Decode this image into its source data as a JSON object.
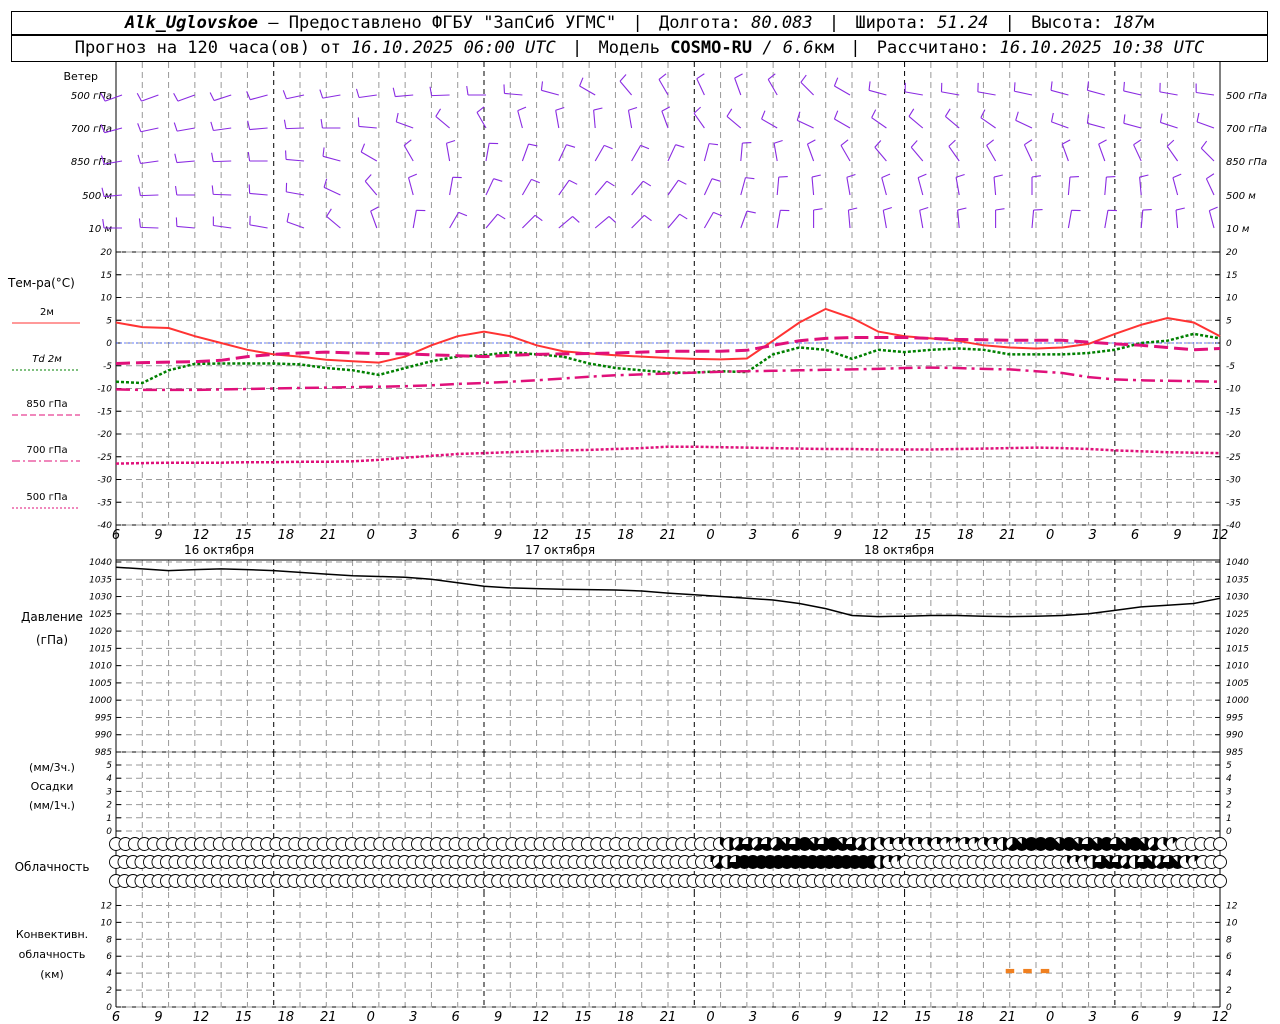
{
  "header": {
    "station": "Alk_Uglovskoe",
    "provider": "– Предоставлено ФГБУ \"ЗапСиб УГМС\"",
    "lon_label": "Долгота:",
    "lon_value": "80.083",
    "lat_label": "Широта:",
    "lat_value": "51.24",
    "alt_label": "Высота:",
    "alt_value": "187",
    "alt_unit": "м",
    "forecast_label": "Прогноз на 120 часа(ов) от",
    "forecast_time": "16.10.2025 06:00 UTC",
    "model_label": "Модель",
    "model_name": "COSMO-RU",
    "model_res": "/ 6.6",
    "model_res_unit": "км",
    "calc_label": "Рассчитано:",
    "calc_time": "16.10.2025 10:38 UTC"
  },
  "wind_panel": {
    "title": "Ветер",
    "levels": [
      "500 гПа",
      "700 гПа",
      "850 гПа",
      "500 м",
      "10 м"
    ]
  },
  "temp_panel": {
    "title": "Тем-ра(°C)",
    "legend": [
      {
        "label": "2м",
        "color": "#ff3333",
        "style": "solid"
      },
      {
        "label": "Td 2м",
        "color": "#008000",
        "style": "dotted"
      },
      {
        "label": "850 гПа",
        "color": "#e0107a",
        "style": "dashed"
      },
      {
        "label": "700 гПа",
        "color": "#e0107a",
        "style": "dashdot"
      },
      {
        "label": "500 гПа",
        "color": "#e0107a",
        "style": "dotted"
      }
    ],
    "yticks": [
      20,
      15,
      10,
      5,
      0,
      -5,
      -10,
      -15,
      -20,
      -25,
      -30,
      -35,
      -40
    ],
    "xticks": [
      "6",
      "9",
      "12",
      "15",
      "18",
      "21",
      "0",
      "3",
      "6",
      "9",
      "12",
      "15",
      "18",
      "21",
      "0",
      "3",
      "6",
      "9",
      "12",
      "15",
      "18",
      "21",
      "0",
      "3",
      "6",
      "9",
      "12"
    ],
    "dates": [
      "16 октября",
      "17 октября",
      "18 октября"
    ]
  },
  "pressure_panel": {
    "title1": "Давление",
    "title2": "(гПа)",
    "yticks": [
      1040,
      1035,
      1030,
      1025,
      1020,
      1015,
      1010,
      1005,
      1000,
      995,
      990,
      985
    ]
  },
  "precip_panel": {
    "title1": "(мм/3ч.)",
    "title2": "Осадки",
    "title3": "(мм/1ч.)",
    "yticks": [
      5,
      4,
      3,
      2,
      1,
      0
    ]
  },
  "cloud_panel": {
    "title": "Облачность"
  },
  "convective_panel": {
    "title1": "Конвективн.",
    "title2": "облачность",
    "title3": "(км)",
    "yticks": [
      12,
      10,
      8,
      6,
      4,
      2,
      0
    ],
    "bar_color": "#f08020"
  },
  "chart_data": [
    {
      "type": "line",
      "name": "Температура",
      "x_hours": [
        0,
        3,
        6,
        9,
        12,
        15,
        18,
        21,
        24,
        27,
        30,
        33,
        36,
        39,
        42,
        45,
        48,
        51,
        54,
        57,
        60,
        63,
        66,
        69,
        72,
        75,
        78,
        81,
        84,
        87,
        90,
        93,
        96,
        99,
        102,
        105,
        108,
        111,
        114,
        117,
        120,
        123,
        126
      ],
      "ylim": [
        -40,
        20
      ],
      "series": [
        {
          "name": "2м",
          "values": [
            4.5,
            3.5,
            3.3,
            1.5,
            0,
            -1.5,
            -2.5,
            -3,
            -3.7,
            -4,
            -4.3,
            -3,
            -0.5,
            1.5,
            2.5,
            1.5,
            -0.5,
            -1.8,
            -2.3,
            -2.7,
            -3,
            -3.3,
            -3.5,
            -3.6,
            -3.4,
            0.5,
            4.5,
            7.5,
            5.5,
            2.5,
            1.5,
            1,
            0.5,
            -0.5,
            -1,
            -1.2,
            -1,
            -0.2,
            2,
            4,
            5.5,
            4.5,
            1.5
          ]
        },
        {
          "name": "Td 2м",
          "values": [
            -8.5,
            -8.8,
            -6,
            -4.6,
            -4.5,
            -4.5,
            -4.5,
            -4.7,
            -5.5,
            -6,
            -7,
            -5.5,
            -4,
            -3,
            -2.7,
            -2,
            -2.5,
            -3,
            -4.5,
            -5.5,
            -6,
            -6.5,
            -6.5,
            -6.2,
            -6.4,
            -2.5,
            -1,
            -1.5,
            -3.5,
            -1.5,
            -2,
            -1.5,
            -1.2,
            -1.5,
            -2.5,
            -2.5,
            -2.5,
            -2.2,
            -1.5,
            0,
            0.5,
            2,
            1
          ]
        },
        {
          "name": "850 гПа",
          "values": [
            -4.5,
            -4.3,
            -4.2,
            -4.1,
            -3.8,
            -3,
            -2.5,
            -2.2,
            -2,
            -2.2,
            -2.3,
            -2.4,
            -2.6,
            -2.8,
            -3,
            -2.7,
            -2.5,
            -2.4,
            -2.3,
            -2.2,
            -2,
            -1.8,
            -1.8,
            -1.8,
            -1.6,
            -0.5,
            0.5,
            1,
            1.2,
            1.2,
            1.2,
            1,
            0.8,
            0.7,
            0.6,
            0.6,
            0.6,
            0.2,
            -0.2,
            -0.5,
            -1,
            -1.5,
            -1.2
          ]
        },
        {
          "name": "700 гПа",
          "values": [
            -10.2,
            -10.3,
            -10.3,
            -10.3,
            -10.2,
            -10.1,
            -10,
            -9.9,
            -9.8,
            -9.7,
            -9.6,
            -9.5,
            -9.3,
            -9,
            -8.8,
            -8.5,
            -8.2,
            -7.8,
            -7.4,
            -7.1,
            -6.9,
            -6.7,
            -6.5,
            -6.3,
            -6.2,
            -6.1,
            -6,
            -5.9,
            -5.8,
            -5.7,
            -5.5,
            -5.4,
            -5.5,
            -5.7,
            -5.8,
            -6.2,
            -6.6,
            -7.5,
            -8,
            -8.2,
            -8.3,
            -8.4,
            -8.5
          ]
        },
        {
          "name": "500 гПа",
          "values": [
            -26.5,
            -26.4,
            -26.3,
            -26.3,
            -26.3,
            -26.2,
            -26.2,
            -26.1,
            -26.1,
            -26,
            -25.7,
            -25.2,
            -24.8,
            -24.4,
            -24.2,
            -24,
            -23.8,
            -23.6,
            -23.5,
            -23.3,
            -23.1,
            -22.8,
            -22.8,
            -22.9,
            -23,
            -23.1,
            -23.2,
            -23.3,
            -23.3,
            -23.4,
            -23.4,
            -23.4,
            -23.3,
            -23.2,
            -23.1,
            -23,
            -23.1,
            -23.3,
            -23.6,
            -23.8,
            -24,
            -24.1,
            -24.2
          ]
        }
      ]
    },
    {
      "type": "line",
      "name": "Давление",
      "x_hours": [
        0,
        3,
        6,
        9,
        12,
        15,
        18,
        21,
        24,
        27,
        30,
        33,
        36,
        39,
        42,
        45,
        48,
        51,
        54,
        57,
        60,
        63,
        66,
        69,
        72,
        75,
        78,
        81,
        84,
        87,
        90,
        93,
        96,
        99,
        102,
        105,
        108,
        111,
        114,
        117,
        120,
        123,
        126
      ],
      "ylim": [
        985,
        1040
      ],
      "series": [
        {
          "name": "Давление",
          "values": [
            1038.5,
            1038,
            1037.5,
            1037.8,
            1038,
            1037.8,
            1037.5,
            1037,
            1036.5,
            1036,
            1035.8,
            1035.6,
            1035,
            1034,
            1033,
            1032.5,
            1032.3,
            1032.1,
            1032,
            1031.9,
            1031.6,
            1031,
            1030.5,
            1030,
            1029.5,
            1029,
            1028,
            1026.5,
            1024.5,
            1024.2,
            1024.3,
            1024.5,
            1024.5,
            1024.3,
            1024.2,
            1024.3,
            1024.5,
            1025,
            1026,
            1027,
            1027.5,
            1028,
            1029.5
          ]
        }
      ]
    },
    {
      "type": "bar",
      "name": "Конвективная облачность",
      "x_hours": [
        102,
        104,
        106
      ],
      "bar_range_km": [
        [
          4,
          4.5
        ],
        [
          4,
          4.5
        ],
        [
          4,
          4.5
        ]
      ]
    }
  ],
  "cloud_cover": {
    "rows": [
      [
        0,
        0,
        0,
        0,
        0,
        0,
        0,
        0,
        0,
        0,
        0,
        0,
        0,
        0,
        0,
        0,
        0,
        0,
        0,
        0,
        0,
        0,
        0,
        0,
        0,
        0,
        0,
        0,
        0,
        0,
        0,
        0,
        0,
        0,
        0,
        0,
        0,
        0,
        0,
        0,
        0,
        0,
        0,
        0,
        0,
        0,
        0,
        0,
        0,
        0,
        0,
        0,
        0,
        0,
        0,
        0,
        0,
        0,
        0,
        0,
        0,
        0,
        0,
        0,
        3,
        4,
        5,
        6,
        5,
        6,
        5,
        7,
        6,
        8,
        7,
        6,
        8,
        7,
        6,
        5,
        4,
        3,
        2,
        2,
        3,
        2,
        3,
        2,
        1,
        1,
        2,
        1,
        3,
        2,
        4,
        5,
        7,
        8,
        8,
        8,
        7,
        8,
        7,
        6,
        7,
        8,
        6,
        7,
        8,
        7,
        5,
        3,
        1,
        0,
        0,
        0,
        0,
        0
      ],
      [
        0,
        0,
        0,
        0,
        0,
        0,
        0,
        0,
        0,
        0,
        0,
        0,
        0,
        0,
        0,
        0,
        0,
        0,
        0,
        0,
        0,
        0,
        0,
        0,
        0,
        0,
        0,
        0,
        0,
        0,
        0,
        0,
        0,
        0,
        0,
        0,
        0,
        0,
        0,
        0,
        0,
        0,
        0,
        0,
        0,
        0,
        0,
        0,
        0,
        0,
        0,
        0,
        0,
        0,
        0,
        0,
        0,
        0,
        0,
        0,
        0,
        0,
        0,
        0,
        0,
        0,
        0,
        0,
        0,
        0,
        2,
        5,
        4,
        6,
        8,
        8,
        8,
        8,
        8,
        8,
        8,
        8,
        8,
        8,
        8,
        8,
        8,
        8,
        8,
        8,
        4,
        2,
        1,
        0,
        0,
        0,
        0,
        0,
        0,
        0,
        0,
        0,
        0,
        0,
        0,
        0,
        0,
        0,
        0,
        0,
        0,
        0,
        3,
        2,
        1,
        4,
        6,
        7,
        6,
        5,
        4,
        6,
        7,
        5,
        6,
        7,
        3,
        1,
        0,
        0,
        0
      ],
      [
        0,
        0,
        0,
        0,
        0,
        0,
        0,
        0,
        0,
        0,
        0,
        0,
        0,
        0,
        0,
        0,
        0,
        0,
        0,
        0,
        0,
        0,
        0,
        0,
        0,
        0,
        0,
        0,
        0,
        0,
        0,
        0,
        0,
        0,
        0,
        0,
        0,
        0,
        0,
        0,
        0,
        0,
        0,
        0,
        0,
        0,
        0,
        0,
        0,
        0,
        0,
        0,
        0,
        0,
        0,
        0,
        0,
        0,
        0,
        0,
        0,
        0,
        0,
        0,
        0,
        0,
        0,
        0,
        0,
        0,
        0,
        0,
        0,
        0,
        0,
        0,
        0,
        0,
        0,
        0,
        0,
        0,
        0,
        0,
        0,
        0,
        0,
        0,
        0,
        0,
        0,
        0,
        0,
        0,
        0,
        0,
        0,
        0,
        0,
        0,
        0,
        0,
        0,
        0,
        0,
        0,
        0,
        0,
        0,
        0,
        0,
        0,
        0,
        0,
        0,
        0,
        0,
        0,
        0,
        0,
        0,
        0,
        0,
        0,
        0,
        0,
        0,
        0,
        0,
        0,
        0
      ]
    ]
  },
  "wind": {
    "levels": [
      {
        "name": "500 гПа",
        "dirs": [
          250,
          250,
          250,
          252,
          255,
          258,
          260,
          262,
          265,
          268,
          270,
          275,
          285,
          300,
          320,
          330,
          335,
          340,
          330,
          315,
          300,
          285,
          280,
          280,
          280,
          282,
          285,
          285,
          283,
          280,
          278
        ]
      },
      {
        "name": "700 гПа",
        "dirs": [
          255,
          258,
          260,
          262,
          265,
          268,
          270,
          275,
          290,
          310,
          330,
          345,
          350,
          355,
          350,
          340,
          325,
          310,
          300,
          295,
          300,
          305,
          310,
          310,
          305,
          295,
          290,
          285,
          285,
          288,
          290
        ]
      },
      {
        "name": "850 гПа",
        "dirs": [
          260,
          262,
          265,
          268,
          270,
          275,
          285,
          300,
          330,
          350,
          10,
          20,
          25,
          30,
          30,
          25,
          15,
          5,
          350,
          340,
          330,
          320,
          320,
          325,
          330,
          335,
          340,
          340,
          335,
          325,
          315
        ]
      },
      {
        "name": "500 м",
        "dirs": [
          265,
          268,
          270,
          272,
          275,
          280,
          295,
          320,
          345,
          10,
          25,
          30,
          35,
          40,
          40,
          35,
          25,
          15,
          5,
          355,
          350,
          345,
          345,
          350,
          355,
          0,
          5,
          5,
          355,
          345,
          335
        ]
      },
      {
        "name": "10 м",
        "dirs": [
          270,
          272,
          275,
          278,
          280,
          290,
          310,
          340,
          10,
          30,
          40,
          45,
          50,
          50,
          45,
          40,
          30,
          20,
          10,
          0,
          355,
          350,
          350,
          355,
          0,
          5,
          10,
          10,
          5,
          355,
          345
        ]
      }
    ]
  }
}
